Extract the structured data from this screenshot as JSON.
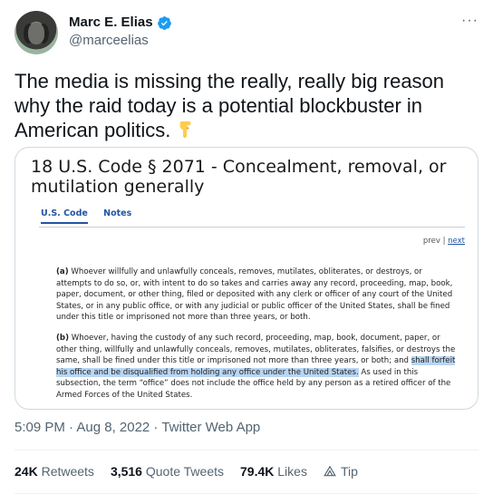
{
  "author": {
    "name": "Marc E. Elias",
    "handle": "@marceelias"
  },
  "more_icon": "ellipsis-icon",
  "tweet": {
    "text": "The media is missing the really, really big reason why the raid today is a potential blockbuster in American politics.",
    "emoji": "pointing-down-hand-emoji"
  },
  "media": {
    "title": "18 U.S. Code § 2071 - Concealment, removal, or mutilation generally",
    "tabs": [
      "U.S. Code",
      "Notes"
    ],
    "prev_label": "prev",
    "pipe": "|",
    "next_label": "next",
    "para_a": {
      "label": "(a)",
      "text": "Whoever willfully and unlawfully conceals, removes, mutilates, obliterates, or destroys, or attempts to do so, or, with intent to do so takes and carries away any record, proceeding, map, book, paper, document, or other thing, filed or deposited with any clerk or officer of any court of the United States, or in any public office, or with any judicial or public officer of the United States, shall be fined under this title or imprisoned not more than three years, or both."
    },
    "para_b": {
      "label": "(b)",
      "text_before": "Whoever, having the custody of any such record, proceeding, map, book, document, paper, or other thing, willfully and unlawfully conceals, removes, mutilates, obliterates, falsifies, or destroys the same, shall be fined under this title or imprisoned not more than three years, or both; and ",
      "highlighted": "shall forfeit his office and be disqualified from holding any office under the United States.",
      "text_after": " As used in this subsection, the term “office” does not include the office held by any person as a retired officer of the Armed Forces of the United States."
    }
  },
  "meta": "5:09 PM · Aug 8, 2022 · Twitter Web App",
  "stats": {
    "retweets_count": "24K",
    "retweets_label": "Retweets",
    "quotes_count": "3,516",
    "quotes_label": "Quote Tweets",
    "likes_count": "79.4K",
    "likes_label": "Likes",
    "tip_label": "Tip"
  },
  "colors": {
    "verified": "#1d9bf0",
    "link": "#2255a4",
    "highlight": "#b9d6f3",
    "secondary_text": "#536471"
  }
}
